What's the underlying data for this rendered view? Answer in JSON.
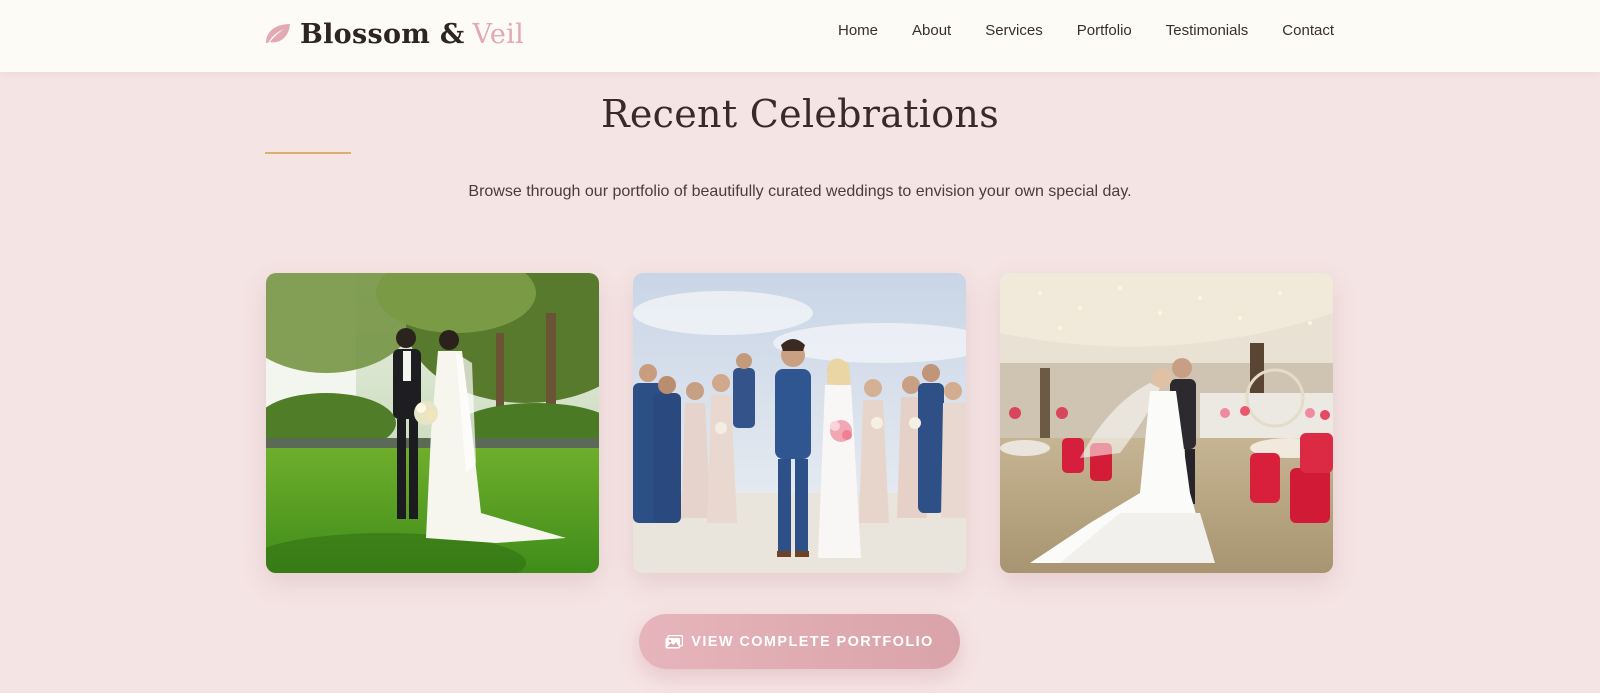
{
  "brand": {
    "name_main": "Blossom &",
    "name_accent": "Veil"
  },
  "nav": {
    "items": [
      "Home",
      "About",
      "Services",
      "Portfolio",
      "Testimonials",
      "Contact"
    ]
  },
  "section": {
    "title": "Recent Celebrations",
    "subtitle": "Browse through our portfolio of beautifully curated weddings to envision your own special day."
  },
  "gallery": {
    "photos": [
      {
        "subject": "garden-wedding-photo"
      },
      {
        "subject": "beach-wedding-party-photo"
      },
      {
        "subject": "ballroom-wedding-photo"
      }
    ]
  },
  "cta": {
    "label": "VIEW COMPLETE PORTFOLIO",
    "icon": "images-icon"
  },
  "colors": {
    "accent_pink": "#e3a9b3",
    "rule_gold": "#d9b06e",
    "background": "#f5e4e4"
  }
}
